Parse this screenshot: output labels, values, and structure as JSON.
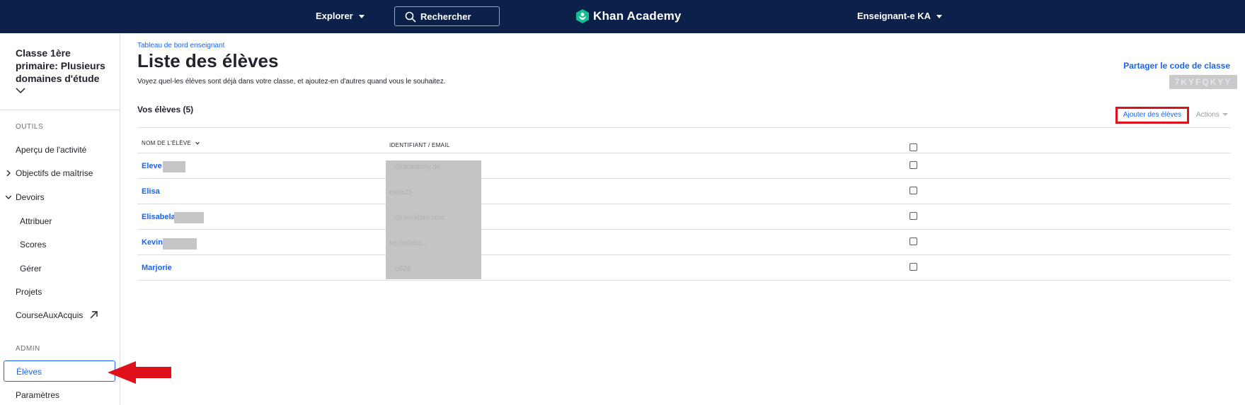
{
  "topbar": {
    "explore_label": "Explorer",
    "search_placeholder": "Rechercher",
    "logo_text": "Khan Academy",
    "user_label": "Enseignant-e KA"
  },
  "sidebar": {
    "class_title": "Classe 1ère primaire: Plusieurs domaines d'étude",
    "tools_heading": "OUTILS",
    "items": {
      "activity": "Aperçu de l'activité",
      "mastery": "Objectifs de maîtrise",
      "assignments": "Devoirs",
      "assign": "Attribuer",
      "scores": "Scores",
      "manage": "Gérer",
      "projects": "Projets",
      "course_challenge": "CourseAuxAcquis"
    },
    "admin_heading": "ADMIN",
    "students": "Élèves",
    "settings": "Paramètres"
  },
  "main": {
    "breadcrumb": "Tableau de bord enseignant",
    "title": "Liste des élèves",
    "description": "Voyez quel-les élèves sont déjà dans votre classe, et ajoutez-en d'autres quand vous le souhaitez.",
    "share_code_link": "Partager le code de classe",
    "class_code": "7KYFQKYY",
    "students_count": "Vos élèves (5)",
    "add_students_button": "Ajouter des élèves",
    "actions_button": "Actions",
    "table": {
      "col_name": "NOM DE L'ÉLÈVE",
      "col_id": "IDENTIFIANT / EMAIL",
      "rows": [
        {
          "name": "Eleve",
          "id": "...@academy.de"
        },
        {
          "name": "Elisa",
          "id": "elela25"
        },
        {
          "name": "Elisabela",
          "id": "...@avekhan.com"
        },
        {
          "name": "Kevin",
          "id": "kevinduba..."
        },
        {
          "name": "Marjorie",
          "id": "...e826"
        }
      ]
    }
  },
  "colors": {
    "nav_bg": "#0b2149",
    "link_blue": "#1865f2",
    "annotation_red": "#e0101a",
    "logo_green": "#14bf96"
  }
}
